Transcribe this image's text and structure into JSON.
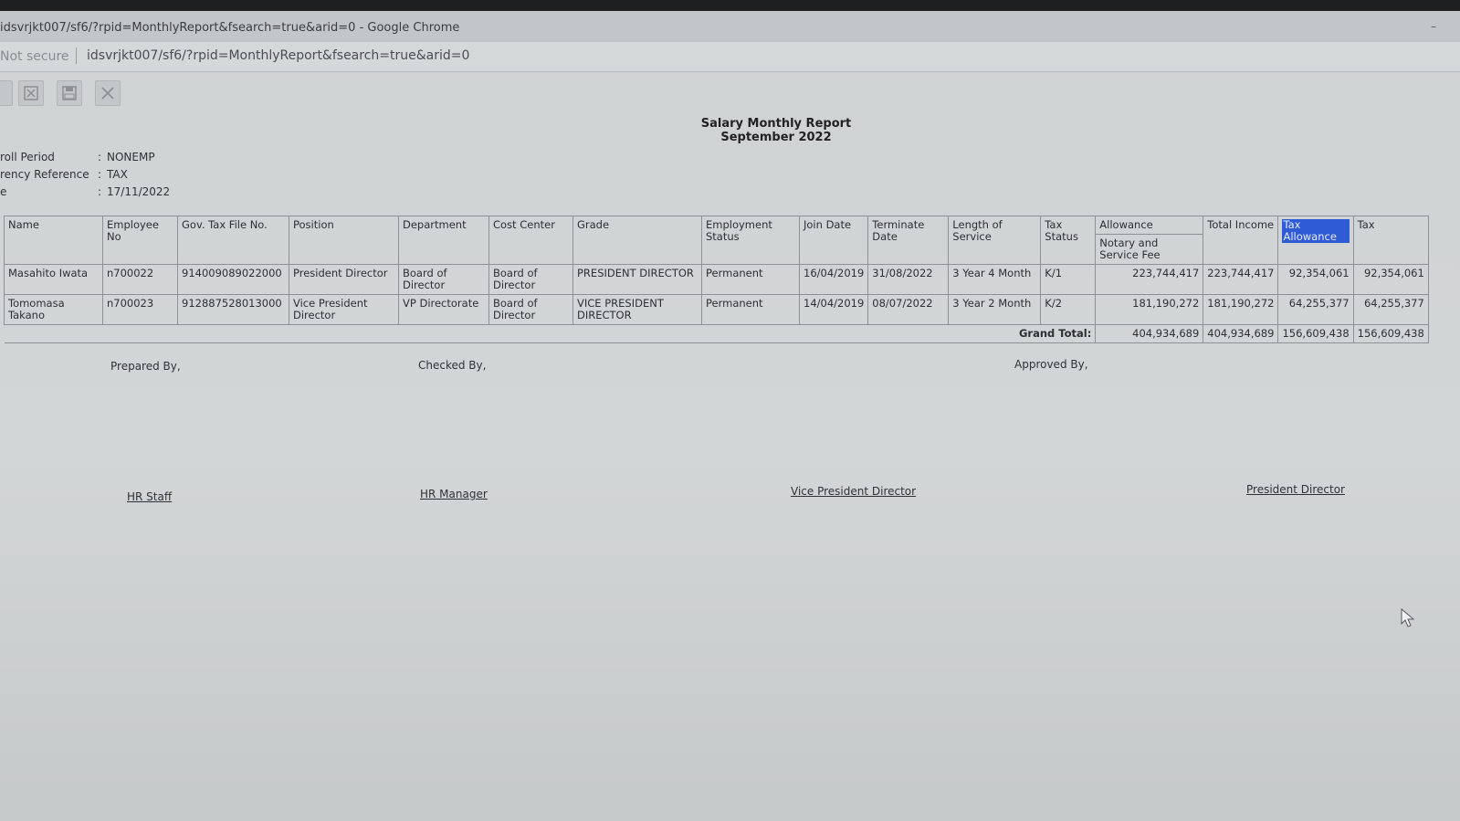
{
  "browser": {
    "window_title": "idsvrjkt007/sf6/?rpid=MonthlyReport&fsearch=true&arid=0 - Google Chrome",
    "security_label": "Not secure",
    "url": "idsvrjkt007/sf6/?rpid=MonthlyReport&fsearch=true&arid=0"
  },
  "toolbar": {
    "icons": [
      "export-excel-icon",
      "save-icon",
      "close-icon"
    ]
  },
  "report": {
    "title": "Salary Monthly Report",
    "period": "September 2022"
  },
  "meta": [
    {
      "label": "roll Period",
      "value": "NONEMP"
    },
    {
      "label": "rency Reference",
      "value": "TAX"
    },
    {
      "label": "e",
      "value": "17/11/2022"
    }
  ],
  "table": {
    "headers": {
      "name": "Name",
      "employee_no": "Employee No",
      "tax_file": "Gov. Tax File No.",
      "position": "Position",
      "department": "Department",
      "cost_center": "Cost Center",
      "grade": "Grade",
      "employment_status": "Employment Status",
      "join_date": "Join Date",
      "terminate_date": "Terminate Date",
      "length_of_service": "Length of Service",
      "tax_status": "Tax Status",
      "allowance": "Allowance",
      "allowance_sub": "Notary and Service Fee",
      "total_income": "Total Income",
      "tax_allowance": "Tax Allowance",
      "tax": "Tax"
    },
    "rows": [
      {
        "name": "Masahito Iwata",
        "employee_no": "n700022",
        "tax_file": "914009089022000",
        "position": "President Director",
        "department": "Board of Director",
        "cost_center": "Board of Director",
        "grade": "PRESIDENT DIRECTOR",
        "employment_status": "Permanent",
        "join_date": "16/04/2019",
        "terminate_date": "31/08/2022",
        "length_of_service": "3 Year 4 Month",
        "tax_status": "K/1",
        "allowance": "223,744,417",
        "total_income": "223,744,417",
        "tax_allowance": "92,354,061",
        "tax": "92,354,061"
      },
      {
        "name": "Tomomasa Takano",
        "employee_no": "n700023",
        "tax_file": "912887528013000",
        "position": "Vice President Director",
        "department": "VP Directorate",
        "cost_center": "Board of Director",
        "grade": "VICE PRESIDENT DIRECTOR",
        "employment_status": "Permanent",
        "join_date": "14/04/2019",
        "terminate_date": "08/07/2022",
        "length_of_service": "3 Year 2 Month",
        "tax_status": "K/2",
        "allowance": "181,190,272",
        "total_income": "181,190,272",
        "tax_allowance": "64,255,377",
        "tax": "64,255,377"
      }
    ],
    "grand_total": {
      "label": "Grand Total:",
      "allowance": "404,934,689",
      "total_income": "404,934,689",
      "tax_allowance": "156,609,438",
      "tax": "156,609,438"
    }
  },
  "signatures": {
    "prepared_by": "Prepared By,",
    "checked_by": "Checked By,",
    "approved_by": "Approved By,",
    "names": [
      "HR Staff",
      "HR Manager",
      "Vice President Director",
      "President Director"
    ]
  }
}
